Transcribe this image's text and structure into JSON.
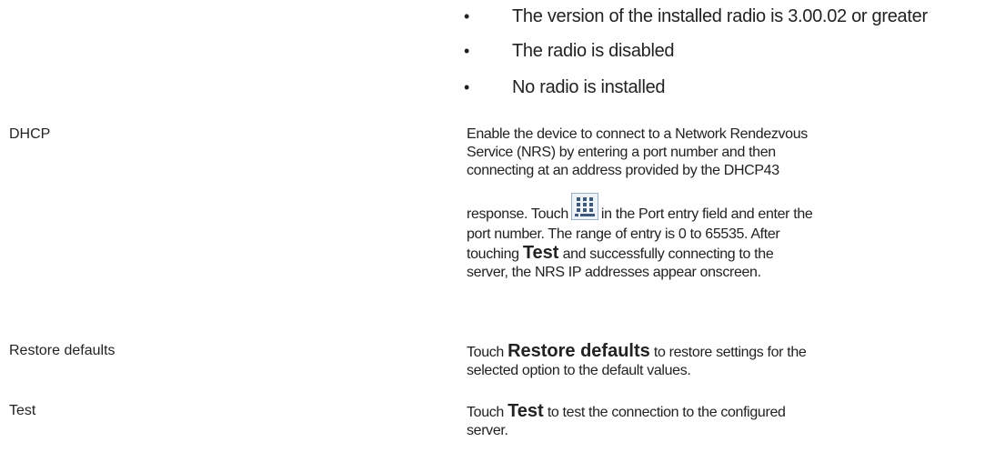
{
  "conditions": [
    "The version of the installed radio is 3.00.02 or greater",
    "The radio is disabled",
    "No radio is installed"
  ],
  "bullet_symbol": "•",
  "dhcp": {
    "term": "DHCP",
    "line1": "Enable the device to connect to a Network Rendezvous",
    "line2": "Service (NRS) by entering a port number and then",
    "line3": "connecting at an address provided by the DHCP43",
    "line4_before": "response. Touch",
    "line4_after": "in the Port entry field and enter the",
    "line5": "port number. The range of entry is 0 to 65535. After",
    "line6_before": "touching",
    "line6_bold": "Test",
    "line6_after": "and successfully connecting to the",
    "line7": "server, the NRS IP addresses appear onscreen.",
    "icon": "keypad-icon"
  },
  "restore": {
    "term": "Restore defaults",
    "line1_before": "Touch",
    "line1_bold": "Restore defaults",
    "line1_after": "to restore settings for the",
    "line2": "selected option to the default values."
  },
  "test": {
    "term": "Test",
    "line1_before": "Touch",
    "line1_bold": "Test",
    "line1_after": "to test the connection to the configured",
    "line2": "server."
  }
}
